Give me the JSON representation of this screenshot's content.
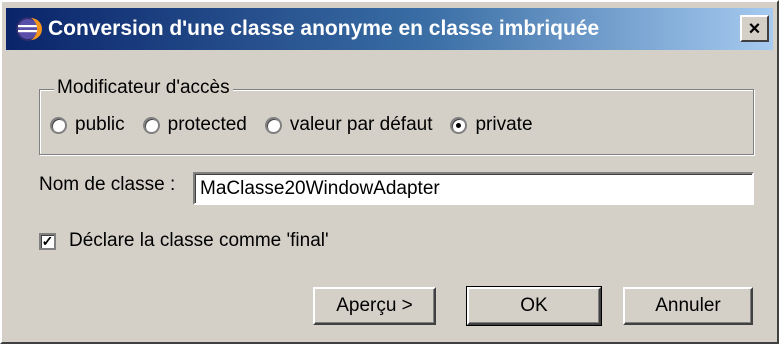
{
  "window": {
    "title": "Conversion d'une classe anonyme en classe imbriquée",
    "close_label": "×",
    "icon": "eclipse-icon"
  },
  "access_group": {
    "legend": "Modificateur d'accès",
    "options": [
      {
        "label": "public",
        "checked": false
      },
      {
        "label": "protected",
        "checked": false
      },
      {
        "label": "valeur par défaut",
        "checked": false
      },
      {
        "label": "private",
        "checked": true
      }
    ]
  },
  "class_name": {
    "label": "Nom de classe :",
    "value": "MaClasse20WindowAdapter"
  },
  "final_checkbox": {
    "label": "Déclare la classe comme 'final'",
    "checked": true
  },
  "buttons": {
    "preview": "Aperçu >",
    "ok": "OK",
    "cancel": "Annuler"
  },
  "colors": {
    "title_start": "#0a246a",
    "title_end": "#a6caf0",
    "face": "#d4d0c8"
  }
}
